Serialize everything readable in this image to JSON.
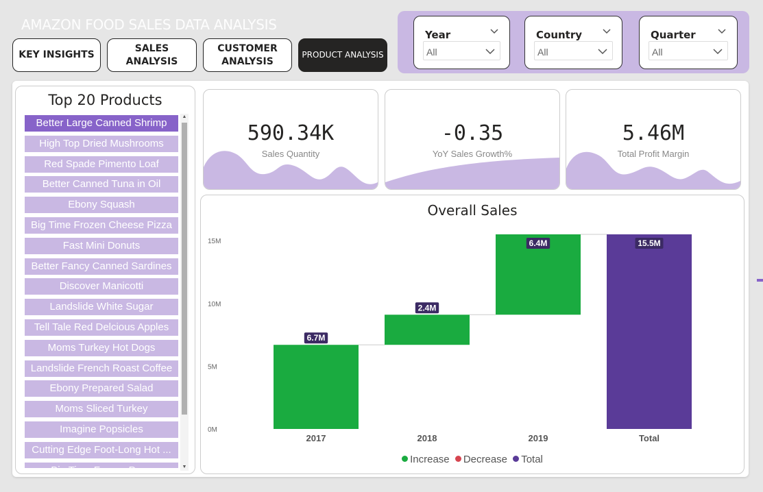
{
  "app": {
    "title": "AMAZON FOOD SALES DATA ANALYSIS"
  },
  "nav": {
    "key_insights": "KEY INSIGHTS",
    "sales_analysis": "SALES ANALYSIS",
    "customer_analysis_1": "CUSTOMER",
    "customer_analysis_2": "ANALYSIS",
    "product_analysis": "PRODUCT ANALYSIS"
  },
  "filters": {
    "year": {
      "label": "Year",
      "value": "All"
    },
    "country": {
      "label": "Country",
      "value": "All"
    },
    "quarter": {
      "label": "Quarter",
      "value": "All"
    }
  },
  "products": {
    "title": "Top 20 Products",
    "items": [
      "Better Large Canned Shrimp",
      "High Top Dried Mushrooms",
      "Red Spade Pimento Loaf",
      "Better Canned Tuna in Oil",
      "Ebony Squash",
      "Big Time Frozen Cheese Pizza",
      "Fast Mini Donuts",
      "Better Fancy Canned Sardines",
      "Discover Manicotti",
      "Landslide White Sugar",
      "Tell Tale Red Delcious Apples",
      "Moms Turkey Hot Dogs",
      "Landslide French Roast Coffee",
      "Ebony Prepared Salad",
      "Moms Sliced Turkey",
      "Imagine Popsicles",
      "Cutting Edge Foot-Long Hot ...",
      "Big Time Frozen Peas"
    ]
  },
  "kpis": {
    "sales_quantity": {
      "value": "590.34K",
      "label": "Sales Quantity"
    },
    "yoy_growth": {
      "value": "-0.35",
      "label": "YoY Sales Growth%"
    },
    "profit_margin": {
      "value": "5.46M",
      "label": "Total Profit Margin"
    }
  },
  "colors": {
    "accent": "#c9b8e3",
    "accent_dark": "#8763c9",
    "increase": "#1aab40",
    "decrease": "#d64550",
    "total": "#5a3b98",
    "label_bg": "#3b2a63"
  },
  "chart_data": {
    "type": "bar",
    "subtype": "waterfall",
    "title": "Overall Sales",
    "categories": [
      "2017",
      "2018",
      "2019",
      "Total"
    ],
    "values": [
      6.7,
      2.4,
      6.4,
      15.5
    ],
    "kinds": [
      "increase",
      "increase",
      "increase",
      "total"
    ],
    "data_labels": [
      "6.7M",
      "2.4M",
      "6.4M",
      "15.5M"
    ],
    "yticks": [
      "0M",
      "5M",
      "10M",
      "15M"
    ],
    "ylim": [
      0,
      15.5
    ],
    "legend": [
      "Increase",
      "Decrease",
      "Total"
    ],
    "legend_position": "bottom"
  }
}
